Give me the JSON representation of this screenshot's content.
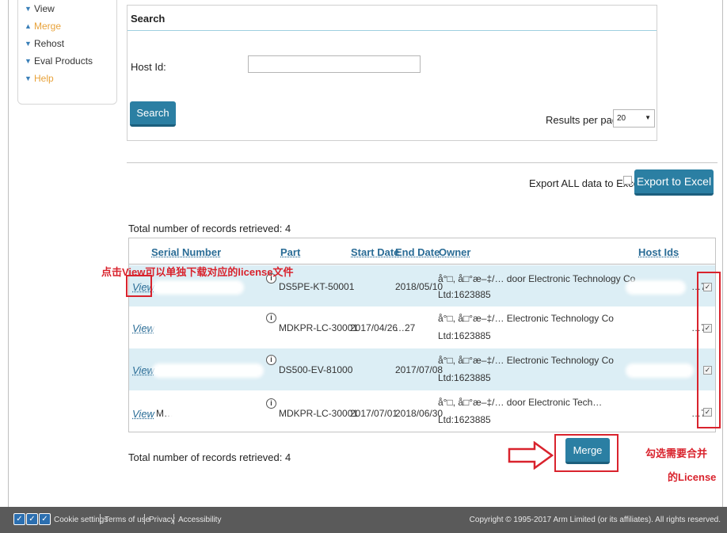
{
  "sidebar": {
    "items": [
      {
        "label": "View"
      },
      {
        "label": "Merge"
      },
      {
        "label": "Rehost"
      },
      {
        "label": "Eval Products"
      },
      {
        "label": "Help"
      }
    ]
  },
  "search": {
    "title": "Search",
    "host_id_label": "Host Id:",
    "host_id_value": "",
    "button": "Search",
    "results_per_page_label": "Results per page:",
    "results_per_page_value": "20"
  },
  "export": {
    "label": "Export ALL data to Excel",
    "button": "Export to Excel"
  },
  "total_records_text": "Total number of records retrieved: 4",
  "table": {
    "headers": {
      "serial": "Serial Number",
      "part": "Part",
      "start": "Start Date",
      "end": "End Date",
      "owner": "Owner",
      "host_ids": "Host Ids"
    },
    "rows": [
      {
        "view": "View",
        "serial": "",
        "part": "DS5PE-KT-50001",
        "start_date": "",
        "end_date": "2018/05/10",
        "owner_line1": "å°□, å□°æ–‡/… door Electronic Technology Co",
        "owner_line2": "Ltd:1623885",
        "host_ids": "…7",
        "checked": true
      },
      {
        "view": "View",
        "serial": "",
        "part": "MDKPR-LC-30001",
        "start_date": "2017/04/26",
        "end_date": "…27",
        "owner_line1": "å°□, å□°æ–‡/… Electronic Technology Co",
        "owner_line2": "Ltd:1623885",
        "host_ids": "…7",
        "checked": true
      },
      {
        "view": "View",
        "serial": "",
        "part": "DS500-EV-81000",
        "start_date": "",
        "end_date": "2017/07/08",
        "owner_line1": "å°□, å□°æ–‡/… Electronic Technology Co",
        "owner_line2": "Ltd:1623885",
        "host_ids": "",
        "checked": true
      },
      {
        "view": "View",
        "serial": "M…",
        "part": "MDKPR-LC-30001",
        "start_date": "2017/07/01",
        "end_date": "2018/06/30",
        "owner_line1": "å°□, å□°æ–‡/… door Electronic Tech…",
        "owner_line2": "Ltd:1623885",
        "host_ids": "…7",
        "checked": true
      }
    ]
  },
  "merge_button": "Merge",
  "annotations": {
    "view_note": "点击View可以单独下载对应的license文件",
    "select_note_line1": "勾选需要合并",
    "select_note_line2": "的License"
  },
  "footer": {
    "links": [
      "Cookie settings",
      "Terms of use",
      "Privacy",
      "Accessibility"
    ],
    "copyright": "Copyright © 1995-2017 Arm Limited (or its affiliates). All rights reserved."
  },
  "colors": {
    "accent_teal": "#2b7fa3",
    "link_blue": "#2a6c96",
    "sidebar_orange": "#e8a23a",
    "annotation_red": "#d9232d",
    "row_shade": "#dceef5",
    "footer_bg": "#5a5a5a"
  }
}
